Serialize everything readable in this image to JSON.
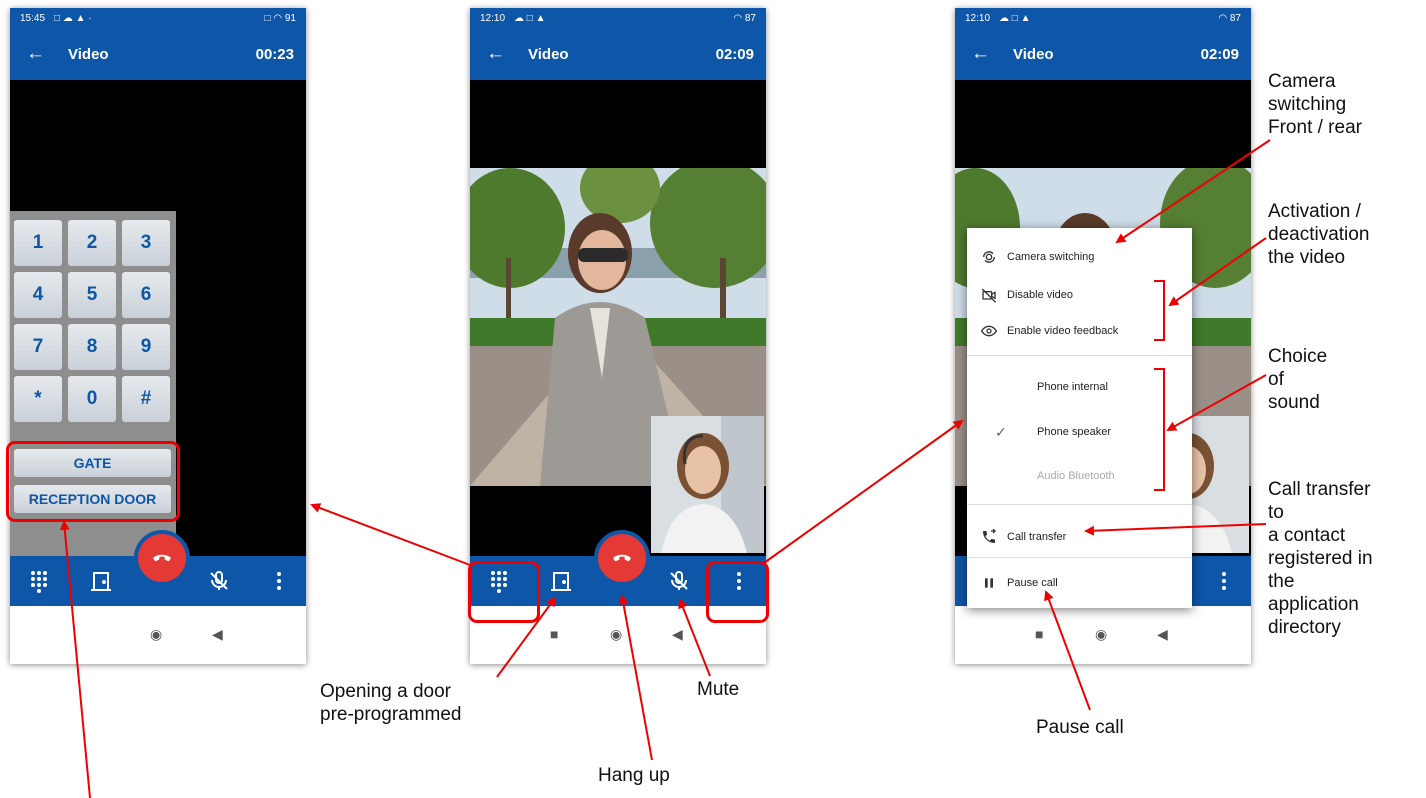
{
  "phone1": {
    "status_time": "15:45",
    "status_icons": "□ ☁ ▲ ·",
    "status_right": "□ ◠ 91",
    "title": "Video",
    "timer": "00:23",
    "keypad": [
      "1",
      "2",
      "3",
      "4",
      "5",
      "6",
      "7",
      "8",
      "9",
      "*",
      "0",
      "#"
    ],
    "door_buttons": [
      "GATE",
      "RECEPTION DOOR"
    ]
  },
  "phone2": {
    "status_time": "12:10",
    "status_icons": "☁ □ ▲",
    "status_right": "◠ 87",
    "title": "Video",
    "timer": "02:09"
  },
  "phone3": {
    "status_time": "12:10",
    "status_icons": "☁ □ ▲",
    "status_right": "◠ 87",
    "title": "Video",
    "timer": "02:09",
    "menu": {
      "camera_switching": "Camera switching",
      "disable_video": "Disable video",
      "enable_video_feedback": "Enable video feedback",
      "phone_internal": "Phone internal",
      "phone_speaker": "Phone speaker",
      "audio_bluetooth": "Audio Bluetooth",
      "call_transfer": "Call transfer",
      "pause_call": "Pause call"
    }
  },
  "annotations": {
    "camera_switching": [
      "Camera",
      "switching",
      "Front / rear"
    ],
    "activation": [
      "Activation /",
      "deactivation",
      "the video"
    ],
    "choice_of_sound": [
      "Choice",
      "of",
      "sound"
    ],
    "call_transfer": [
      "Call transfer",
      "to",
      "a contact",
      "registered in",
      "the",
      "application",
      "directory"
    ],
    "pause_call": "Pause call",
    "opening_door": [
      "Opening a door",
      "pre-programmed"
    ],
    "mute": "Mute",
    "hang_up": "Hang up"
  },
  "colors": {
    "app_blue": "#0e56a8",
    "hangup_red": "#e53935",
    "annotation_red": "#e00000",
    "keypad_gray": "#8e8e8e"
  },
  "icons": {
    "back": "arrow-left-icon",
    "dialpad": "dialpad-icon",
    "door": "door-icon",
    "hangup": "phone-hangup-icon",
    "mute": "mic-off-icon",
    "more": "more-vertical-icon"
  }
}
